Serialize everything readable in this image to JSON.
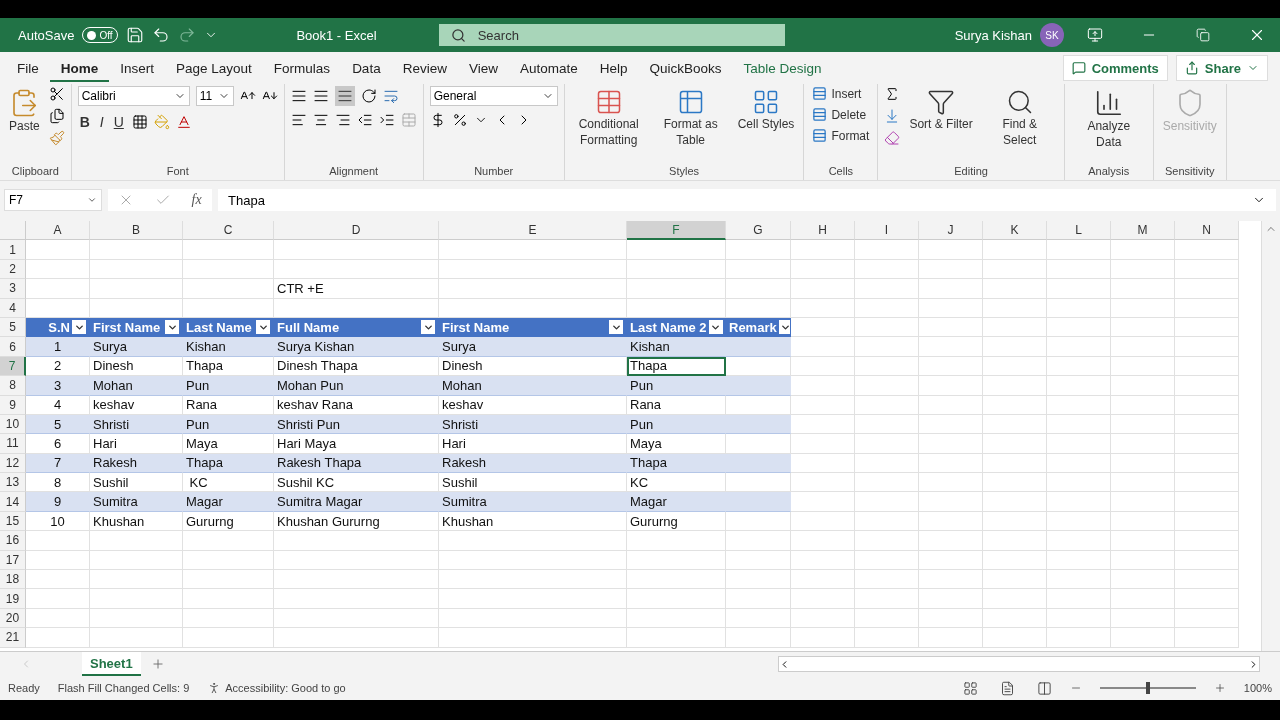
{
  "title_bar": {
    "autosave_label": "AutoSave",
    "autosave_on": false,
    "autosave_state": "Off",
    "title": "Book1  -  Excel",
    "search_placeholder": "Search",
    "user_name": "Surya Kishan",
    "avatar": "SK"
  },
  "menu_tabs": [
    {
      "label": "File",
      "selected": false
    },
    {
      "label": "Home",
      "selected": true
    },
    {
      "label": "Insert",
      "selected": false
    },
    {
      "label": "Page Layout",
      "selected": false
    },
    {
      "label": "Formulas",
      "selected": false
    },
    {
      "label": "Data",
      "selected": false
    },
    {
      "label": "Review",
      "selected": false
    },
    {
      "label": "View",
      "selected": false
    },
    {
      "label": "Automate",
      "selected": false
    },
    {
      "label": "Help",
      "selected": false
    },
    {
      "label": "QuickBooks",
      "selected": false
    },
    {
      "label": "Table Design",
      "selected": false
    }
  ],
  "actions": {
    "comments": "Comments",
    "share": "Share"
  },
  "ribbon": [
    {
      "kind": "clipboard",
      "label": "Clipboard",
      "buttons": [
        "Paste"
      ]
    },
    {
      "kind": "font",
      "label": "Font",
      "font": "Calibri",
      "size": "11",
      "buttons": [
        "B",
        "I",
        "U"
      ]
    },
    {
      "kind": "alignment",
      "label": "Alignment"
    },
    {
      "kind": "number",
      "label": "Number",
      "format": "General"
    },
    {
      "kind": "styles",
      "label": "Styles",
      "buttons": [
        "Conditional Formatting",
        "Format as Table",
        "Cell Styles"
      ]
    },
    {
      "kind": "cells",
      "label": "Cells",
      "buttons": [
        "Insert",
        "Delete",
        "Format"
      ]
    },
    {
      "kind": "editing",
      "label": "Editing",
      "buttons": [
        "Sort & Filter",
        "Find & Select"
      ]
    },
    {
      "kind": "analysis",
      "label": "Analysis",
      "buttons": [
        "Analyze Data"
      ]
    },
    {
      "kind": "sensitivity",
      "label": "Sensitivity",
      "buttons": [
        "Sensitivity"
      ],
      "disabled": true
    }
  ],
  "formula_bar": {
    "name_box": "F7",
    "fx": "fx",
    "value": "Thapa"
  },
  "columns": [
    {
      "label": "A",
      "selected": false
    },
    {
      "label": "B",
      "selected": false
    },
    {
      "label": "C",
      "selected": false
    },
    {
      "label": "D",
      "selected": false
    },
    {
      "label": "E",
      "selected": false
    },
    {
      "label": "F",
      "selected": true
    },
    {
      "label": "G",
      "selected": false
    },
    {
      "label": "H",
      "selected": false
    },
    {
      "label": "I",
      "selected": false
    },
    {
      "label": "J",
      "selected": false
    },
    {
      "label": "K",
      "selected": false
    },
    {
      "label": "L",
      "selected": false
    },
    {
      "label": "M",
      "selected": false
    },
    {
      "label": "N",
      "selected": false
    }
  ],
  "rows": [
    {
      "label": "1",
      "selected": false
    },
    {
      "label": "2",
      "selected": false
    },
    {
      "label": "3",
      "selected": false
    },
    {
      "label": "4",
      "selected": false
    },
    {
      "label": "5",
      "selected": false
    },
    {
      "label": "6",
      "selected": false
    },
    {
      "label": "7",
      "selected": true
    },
    {
      "label": "8",
      "selected": false
    },
    {
      "label": "9",
      "selected": false
    },
    {
      "label": "10",
      "selected": false
    },
    {
      "label": "11",
      "selected": false
    },
    {
      "label": "12",
      "selected": false
    },
    {
      "label": "13",
      "selected": false
    },
    {
      "label": "14",
      "selected": false
    },
    {
      "label": "15",
      "selected": false
    },
    {
      "label": "16",
      "selected": false
    },
    {
      "label": "17",
      "selected": false
    },
    {
      "label": "18",
      "selected": false
    },
    {
      "label": "19",
      "selected": false
    },
    {
      "label": "20",
      "selected": false
    },
    {
      "label": "21",
      "selected": false
    }
  ],
  "note_cell": "CTR +E",
  "table": {
    "headers": [
      "S.N",
      "First Name",
      "Last Name",
      "Full Name",
      "First Name",
      "Last Name 2",
      "Remark"
    ],
    "rows": [
      [
        "1",
        "Surya",
        "Kishan",
        "Surya Kishan",
        "Surya",
        "Kishan"
      ],
      [
        "2",
        "Dinesh",
        "Thapa",
        "Dinesh Thapa",
        "Dinesh",
        "Thapa"
      ],
      [
        "3",
        "Mohan",
        "Pun",
        "Mohan Pun",
        "Mohan",
        "Pun"
      ],
      [
        "4",
        "keshav",
        "Rana",
        "keshav Rana",
        "keshav",
        "Rana"
      ],
      [
        "5",
        "Shristi",
        "Pun",
        "Shristi Pun",
        "Shristi",
        "Pun"
      ],
      [
        "6",
        "Hari",
        "Maya",
        "Hari Maya",
        "Hari",
        "Maya"
      ],
      [
        "7",
        "Rakesh",
        "Thapa",
        "Rakesh Thapa",
        "Rakesh",
        "Thapa"
      ],
      [
        "8",
        "Sushil",
        " KC",
        "Sushil KC",
        "Sushil",
        "KC"
      ],
      [
        "9",
        "Sumitra",
        "Magar",
        "Sumitra Magar",
        "Sumitra",
        "Magar"
      ],
      [
        "10",
        "Khushan",
        "Gururng",
        "Khushan Gururng",
        "Khushan",
        "Gururng"
      ]
    ]
  },
  "sheet_tabs": [
    {
      "label": "Sheet1",
      "selected": true
    }
  ],
  "status_bar": {
    "ready": "Ready",
    "flash_fill": "Flash Fill Changed Cells: 9",
    "accessibility": "Accessibility: Good to go",
    "zoom": "100%",
    "zoom_level": {
      "level": 0.5
    }
  }
}
